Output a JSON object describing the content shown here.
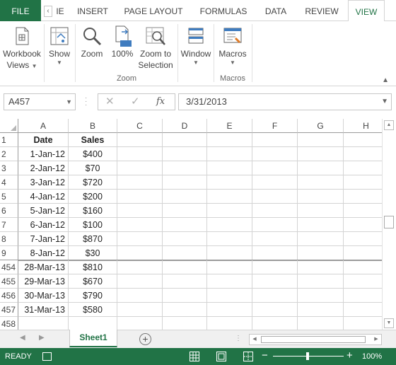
{
  "ribbon_tabs": [
    {
      "label": "FILE"
    },
    {
      "label": "‹"
    },
    {
      "label": "IE"
    },
    {
      "label": "INSERT"
    },
    {
      "label": "PAGE LAYOUT"
    },
    {
      "label": "FORMULAS"
    },
    {
      "label": "DATA"
    },
    {
      "label": "REVIEW"
    },
    {
      "label": "VIEW"
    }
  ],
  "ribbon": {
    "workbook_views": {
      "line1": "Workbook",
      "line2": "Views",
      "icon": "workbook-views-icon"
    },
    "show": {
      "label": "Show",
      "icon": "show-icon"
    },
    "zoom": {
      "label": "Zoom",
      "icon": "magnifier-icon"
    },
    "zoom100": {
      "label": "100%",
      "icon": "zoom-100-icon",
      "badge": "100"
    },
    "zoom_selection": {
      "line1": "Zoom to",
      "line2": "Selection",
      "icon": "zoom-to-selection-icon"
    },
    "window": {
      "label": "Window",
      "icon": "window-icon"
    },
    "macros": {
      "label": "Macros",
      "icon": "macros-icon"
    },
    "group_zoom": "Zoom",
    "group_macros": "Macros"
  },
  "formula_bar": {
    "name_box": "A457",
    "cancel": "✕",
    "enter": "✓",
    "fx": "fx",
    "value": "3/31/2013"
  },
  "columns": [
    "A",
    "B",
    "C",
    "D",
    "E",
    "F",
    "G",
    "H"
  ],
  "rows": [
    {
      "num": "1",
      "a": "Date",
      "b": "Sales"
    },
    {
      "num": "2",
      "a": "1-Jan-12",
      "b": "$400"
    },
    {
      "num": "3",
      "a": "2-Jan-12",
      "b": "$70"
    },
    {
      "num": "4",
      "a": "3-Jan-12",
      "b": "$720"
    },
    {
      "num": "5",
      "a": "4-Jan-12",
      "b": "$200"
    },
    {
      "num": "6",
      "a": "5-Jan-12",
      "b": "$160"
    },
    {
      "num": "7",
      "a": "6-Jan-12",
      "b": "$100"
    },
    {
      "num": "8",
      "a": "7-Jan-12",
      "b": "$870"
    },
    {
      "num": "9",
      "a": "8-Jan-12",
      "b": "$30"
    },
    {
      "num": "454",
      "a": "28-Mar-13",
      "b": "$810"
    },
    {
      "num": "455",
      "a": "29-Mar-13",
      "b": "$670"
    },
    {
      "num": "456",
      "a": "30-Mar-13",
      "b": "$790"
    },
    {
      "num": "457",
      "a": "31-Mar-13",
      "b": "$580"
    },
    {
      "num": "458",
      "a": "",
      "b": ""
    }
  ],
  "sheet_tabs": {
    "active": "Sheet1",
    "add": "+"
  },
  "status": {
    "ready": "READY",
    "zoom_minus": "−",
    "zoom_plus": "+",
    "zoom_pct": "100%",
    "zoom_level_percent": 100
  },
  "colors": {
    "accent": "#217346",
    "gridline": "#d4d4d4",
    "header_border": "#9b9b9b"
  }
}
